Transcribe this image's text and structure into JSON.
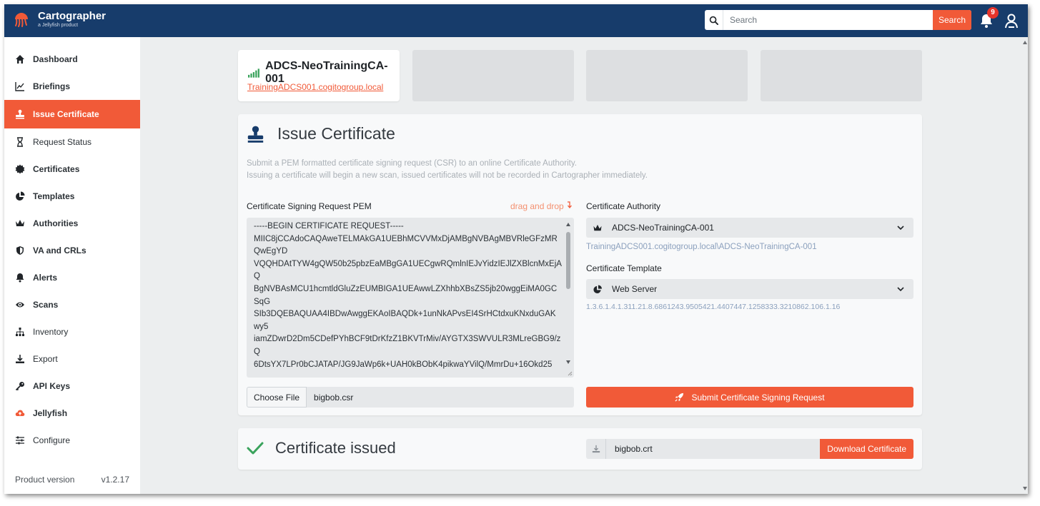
{
  "header": {
    "app_name": "Cartographer",
    "app_subtitle": "a Jellyfish product",
    "search_placeholder": "Search",
    "search_button": "Search",
    "notification_count": "9",
    "brand_color": "#173c6b",
    "accent_color": "#f15a38"
  },
  "sidebar": {
    "items": [
      {
        "label": "Dashboard",
        "icon": "home-icon"
      },
      {
        "label": "Briefings",
        "icon": "chart-line-icon"
      },
      {
        "label": "Issue Certificate",
        "icon": "stamp-icon",
        "active": true
      },
      {
        "label": "Request Status",
        "icon": "hourglass-icon"
      },
      {
        "label": "Certificates",
        "icon": "certificate-icon"
      },
      {
        "label": "Templates",
        "icon": "pie-chart-icon"
      },
      {
        "label": "Authorities",
        "icon": "crown-icon"
      },
      {
        "label": "VA and CRLs",
        "icon": "shield-icon"
      },
      {
        "label": "Alerts",
        "icon": "bell-icon"
      },
      {
        "label": "Scans",
        "icon": "eye-icon"
      },
      {
        "label": "Inventory",
        "icon": "sitemap-icon"
      },
      {
        "label": "Export",
        "icon": "download-icon"
      },
      {
        "label": "API Keys",
        "icon": "key-icon"
      },
      {
        "label": "Jellyfish",
        "icon": "cloud-upload-icon"
      },
      {
        "label": "Configure",
        "icon": "sliders-icon"
      }
    ],
    "version_label": "Product version",
    "version_value": "v1.2.17"
  },
  "ca_card": {
    "name": "ADCS-NeoTrainingCA-001",
    "host": "TrainingADCS001.cogitogroup.local"
  },
  "issue": {
    "title": "Issue Certificate",
    "description_line1": "Submit a PEM formatted certificate signing request (CSR) to an online Certificate Authority.",
    "description_line2": "Issuing a certificate will begin a new scan, issued certificates will not be recorded in Cartographer immediately.",
    "csr_label": "Certificate Signing Request PEM",
    "drag_drop": "drag and drop",
    "csr_text": "-----BEGIN CERTIFICATE REQUEST-----\nMIIC8jCCAdoCAQAweTELMAkGA1UEBhMCVVMxDjAMBgNVBAgMBVRleGFzMR\nQwEgYD\nVQQHDAtTYW4gQW50b25pbzEaMBgGA1UECgwRQmlnIEJvYidzIEJlZXBlcnMxEjA\nQ\nBgNVBAsMCU1hcmtldGluZzEUMBIGA1UEAwwLZXhhbXBsZS5jb20wggEiMA0GC\nSqG\nSIb3DQEBAQUAA4IBDwAwggEKAoIBAQDk+1unNkAPvsEI4SrHCtdxuKNxduGAK\nwy5\niamZDwrD2Dm5CDefPYhBCF9tDrKfzZ1BKVTrMiv/AYGTX3SWVULR3MLreGBG9/z\nQ\n6DtsYX7LPr0bCJATAP/JG9JaWp6k+UAH0kBObK4pikwaYVilQ/MmrDu+16Okd25",
    "choose_file": "Choose File",
    "file_name": "bigbob.csr",
    "ca_label": "Certificate Authority",
    "ca_selected": "ADCS-NeoTrainingCA-001",
    "ca_path": "TrainingADCS001.cogitogroup.local\\ADCS-NeoTrainingCA-001",
    "template_label": "Certificate Template",
    "template_selected": "Web Server",
    "template_oid": "1.3.6.1.4.1.311.21.8.6861243.9505421.4407447.1258333.3210862.106.1.16",
    "submit_button": "Submit Certificate Signing Request"
  },
  "issued": {
    "title": "Certificate issued",
    "file_name": "bigbob.crt",
    "download_button": "Download Certificate",
    "success_color": "#3aa35c"
  }
}
